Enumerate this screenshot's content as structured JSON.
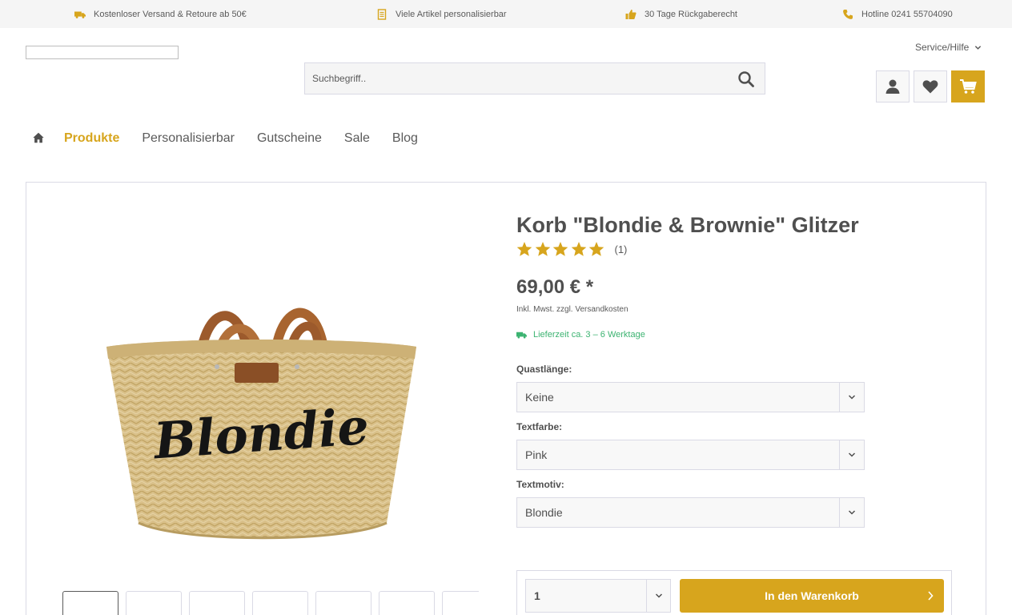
{
  "promo_bar": [
    {
      "icon": "truck-icon",
      "text": "Kostenloser Versand & Retoure ab 50€"
    },
    {
      "icon": "document-icon",
      "text": "Viele Artikel personalisierbar"
    },
    {
      "icon": "thumbs-up-icon",
      "text": "30 Tage Rückgaberecht"
    },
    {
      "icon": "phone-icon",
      "text": "Hotline 0241 55704090"
    }
  ],
  "header": {
    "service_label": "Service/Hilfe",
    "search_placeholder": "Suchbegriff.."
  },
  "nav": {
    "items": [
      "Produkte",
      "Personalisierbar",
      "Gutscheine",
      "Sale",
      "Blog"
    ],
    "active": "Produkte"
  },
  "product": {
    "title": "Korb \"Blondie & Brownie\" Glitzer",
    "rating": 5,
    "rating_count": "(1)",
    "price": "69,00 € *",
    "tax_note": "Inkl. Mwst. zzgl. Versandkosten",
    "delivery": "Lieferzeit ca. 3 – 6 Werktage",
    "image_text": "Blondie",
    "thumbnail_count": 7,
    "options": [
      {
        "label": "Quastlänge:",
        "value": "Keine"
      },
      {
        "label": "Textfarbe:",
        "value": "Pink"
      },
      {
        "label": "Textmotiv:",
        "value": "Blondie"
      }
    ],
    "quantity": "1",
    "add_to_cart_label": "In den Warenkorb"
  },
  "colors": {
    "accent": "#d7a51d",
    "delivery_green": "#3cb371",
    "star": "#d7a51d"
  }
}
